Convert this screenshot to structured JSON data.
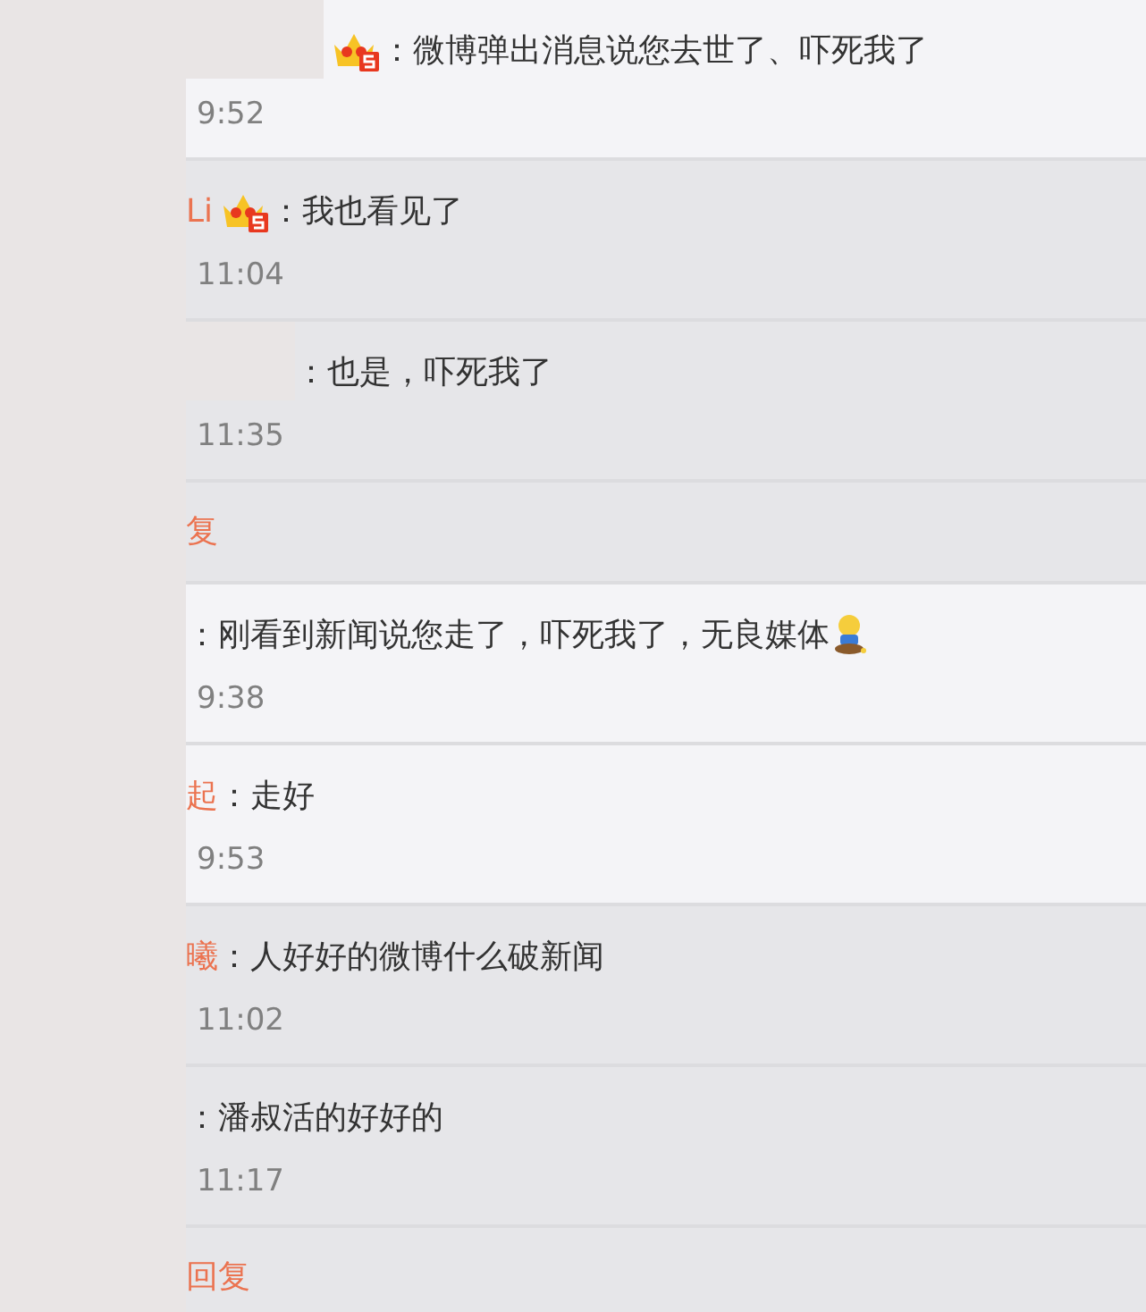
{
  "comments": [
    {
      "kind": "comment",
      "light": true,
      "redacted": true,
      "badge": true,
      "text": "：微博弹出消息说您去世了、吓死我了",
      "emoji": false,
      "time": "9:52"
    },
    {
      "kind": "comment",
      "light": false,
      "redacted": false,
      "name": "Li",
      "badge": true,
      "text": "：我也看见了",
      "emoji": false,
      "time": "11:04"
    },
    {
      "kind": "comment",
      "light": false,
      "redacted": true,
      "badge": false,
      "text": "：也是，吓死我了",
      "emoji": false,
      "time": "11:35"
    },
    {
      "kind": "reply-link",
      "light": false,
      "label": "复"
    },
    {
      "kind": "comment",
      "light": true,
      "redacted": false,
      "badge": false,
      "text": "：刚看到新闻说您走了，吓死我了，无良媒体",
      "emoji": true,
      "time": "9:38"
    },
    {
      "kind": "comment",
      "light": true,
      "redacted": false,
      "name": "起",
      "badge": false,
      "text": "：走好",
      "emoji": false,
      "time": "9:53"
    },
    {
      "kind": "comment",
      "light": false,
      "redacted": false,
      "name": "曦",
      "badge": false,
      "text": "：人好好的微博什么破新闻",
      "emoji": false,
      "time": "11:02"
    },
    {
      "kind": "comment",
      "light": false,
      "redacted": false,
      "badge": false,
      "text": "：潘叔活的好好的",
      "emoji": false,
      "time": "11:17"
    },
    {
      "kind": "reply-link",
      "light": false,
      "label": "回复"
    }
  ]
}
